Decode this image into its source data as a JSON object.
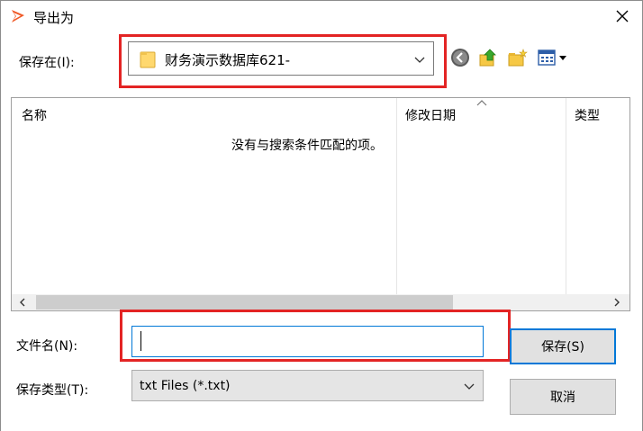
{
  "window": {
    "title": "导出为",
    "close_glyph": "✕"
  },
  "save_in": {
    "label": "保存在(I):",
    "folder": "财务演示数据库621-"
  },
  "nav": {
    "back_icon": "back-circle-icon",
    "up_icon": "up-folder-icon",
    "new_folder_icon": "new-folder-icon",
    "view_icon": "view-menu-icon"
  },
  "file_list": {
    "columns": [
      "名称",
      "修改日期",
      "类型"
    ],
    "empty_message": "没有与搜索条件匹配的项。"
  },
  "filename": {
    "label": "文件名(N):",
    "value": ""
  },
  "filetype": {
    "label": "保存类型(T):",
    "value": "txt Files (*.txt)"
  },
  "buttons": {
    "save": "保存(S)",
    "cancel": "取消"
  },
  "colors": {
    "highlight_red": "#e32424",
    "accent_blue": "#0078d7"
  }
}
